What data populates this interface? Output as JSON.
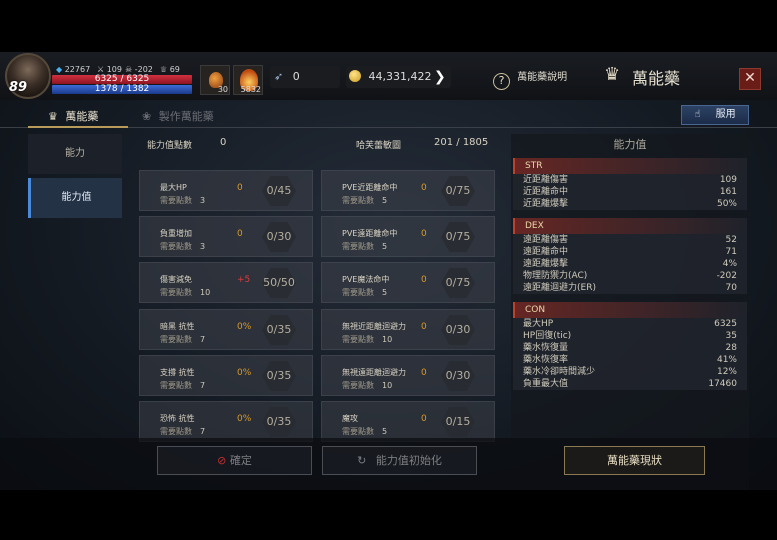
{
  "header": {
    "level": "89",
    "stat1": "22767",
    "stat2": "109",
    "stat3": "-202",
    "stat4": "69",
    "hp": "6325 / 6325",
    "mp": "1378 / 1382",
    "item1_count": "30",
    "item2_count": "5832",
    "feather_count": "0",
    "gold": "44,331,422",
    "help_label": "萬能藥說明",
    "title": "萬能藥",
    "close": "✕"
  },
  "tabs": {
    "active": "萬能藥",
    "inactive": "製作萬能藥",
    "use_button": "服用"
  },
  "side": {
    "item1": "能力",
    "item2": "能力值"
  },
  "points": {
    "label": "能力值點數",
    "value": "0",
    "sheet_label": "哈芙蕾敏圖",
    "sheet_value": "201 / 1805"
  },
  "left_stats": [
    {
      "name": "最大HP",
      "req_label": "需要點數",
      "req": "3",
      "value": "0",
      "max": "0/45",
      "red": false
    },
    {
      "name": "負重增加",
      "req_label": "需要點數",
      "req": "3",
      "value": "0",
      "max": "0/30",
      "red": false
    },
    {
      "name": "傷害減免",
      "req_label": "需要點數",
      "req": "10",
      "value": "+5",
      "max": "50/50",
      "red": true
    },
    {
      "name": "暗黑 抗性",
      "req_label": "需要點數",
      "req": "7",
      "value": "0%",
      "max": "0/35",
      "red": false
    },
    {
      "name": "支撐 抗性",
      "req_label": "需要點數",
      "req": "7",
      "value": "0%",
      "max": "0/35",
      "red": false
    },
    {
      "name": "恐怖 抗性",
      "req_label": "需要點數",
      "req": "7",
      "value": "0%",
      "max": "0/35",
      "red": false
    }
  ],
  "right_stats": [
    {
      "name": "PVE近距離命中",
      "req_label": "需要點數",
      "req": "5",
      "value": "0",
      "max": "0/75"
    },
    {
      "name": "PVE遠距離命中",
      "req_label": "需要點數",
      "req": "5",
      "value": "0",
      "max": "0/75"
    },
    {
      "name": "PVE魔法命中",
      "req_label": "需要點數",
      "req": "5",
      "value": "0",
      "max": "0/75"
    },
    {
      "name": "無視近距離迴避力",
      "req_label": "需要點數",
      "req": "10",
      "value": "0",
      "max": "0/30"
    },
    {
      "name": "無視遠距離迴避力",
      "req_label": "需要點數",
      "req": "10",
      "value": "0",
      "max": "0/30"
    },
    {
      "name": "魔攻",
      "req_label": "需要點數",
      "req": "5",
      "value": "0",
      "max": "0/15"
    }
  ],
  "panel": {
    "title": "能力值",
    "groups": [
      {
        "head": "STR",
        "rows": [
          [
            "近距離傷害",
            "109"
          ],
          [
            "近距離命中",
            "161"
          ],
          [
            "近距離爆擊",
            "50%"
          ]
        ]
      },
      {
        "head": "DEX",
        "rows": [
          [
            "遠距離傷害",
            "52"
          ],
          [
            "遠距離命中",
            "71"
          ],
          [
            "遠距離爆擊",
            "4%"
          ],
          [
            "物理防禦力(AC)",
            "-202"
          ],
          [
            "遠距離迴避力(ER)",
            "70"
          ]
        ]
      },
      {
        "head": "CON",
        "rows": [
          [
            "最大HP",
            "6325"
          ],
          [
            "HP回復(tic)",
            "35"
          ],
          [
            "藥水恢復量",
            "28"
          ],
          [
            "藥水恢復率",
            "41%"
          ],
          [
            "藥水冷卻時間減少",
            "12%"
          ],
          [
            "負重最大值",
            "17460"
          ]
        ]
      }
    ]
  },
  "bottom": {
    "btn1": "確定",
    "btn2": "能力值初始化",
    "btn3": "萬能藥現狀"
  },
  "colors": {
    "accent_gold": "#b89a5a",
    "close_red": "#6a1c16",
    "active_blue": "#243246"
  }
}
